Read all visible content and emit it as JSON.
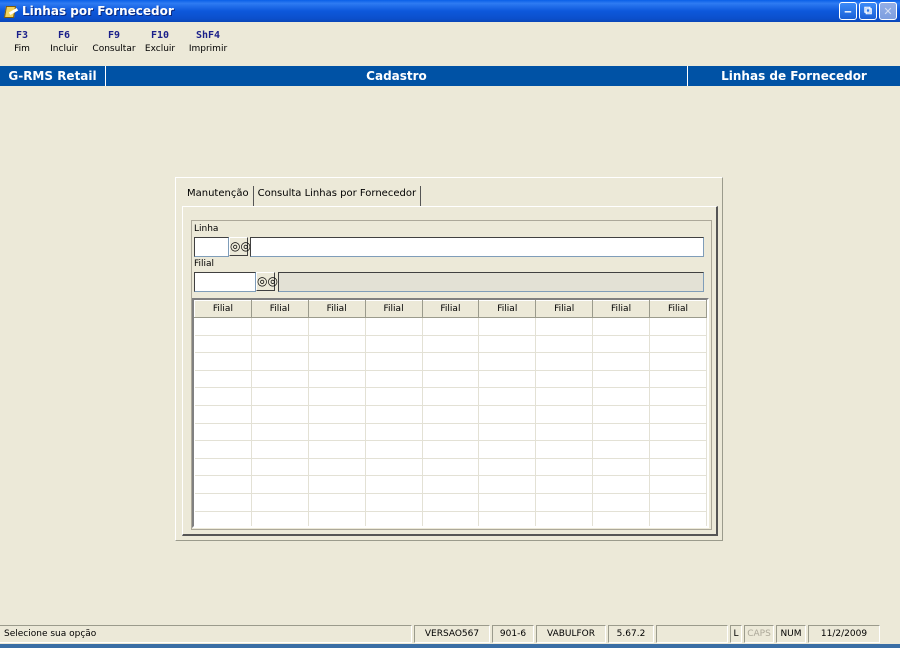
{
  "window": {
    "title": "Linhas por Fornecedor"
  },
  "fkeys": [
    {
      "key": "F3",
      "label": "Fim"
    },
    {
      "key": "F6",
      "label": "Incluir"
    },
    {
      "key": "F9",
      "label": "Consultar"
    },
    {
      "key": "F10",
      "label": "Excluir"
    },
    {
      "key": "ShF4",
      "label": "Imprimir"
    }
  ],
  "header": {
    "left": "G-RMS Retail",
    "center": "Cadastro",
    "right": "Linhas de Fornecedor"
  },
  "tabs": [
    {
      "label": "Manutenção"
    },
    {
      "label": "Consulta Linhas por Fornecedor"
    }
  ],
  "form": {
    "linha_label": "Linha",
    "linha_value": "",
    "linha_desc": "",
    "filial_label": "Filial",
    "filial_value": "",
    "filial_desc": ""
  },
  "grid": {
    "columns": [
      "Filial",
      "Filial",
      "Filial",
      "Filial",
      "Filial",
      "Filial",
      "Filial",
      "Filial",
      "Filial"
    ]
  },
  "status": {
    "message": "Selecione sua opção",
    "versao": "VERSAO567",
    "code": "901-6",
    "user": "VABULFOR",
    "version_num": "5.67.2",
    "empty": "",
    "l": "L",
    "caps": "CAPS",
    "num": "NUM",
    "date": "11/2/2009"
  },
  "icons": {
    "app": "app-pencil-icon",
    "search": "binoculars-icon"
  }
}
